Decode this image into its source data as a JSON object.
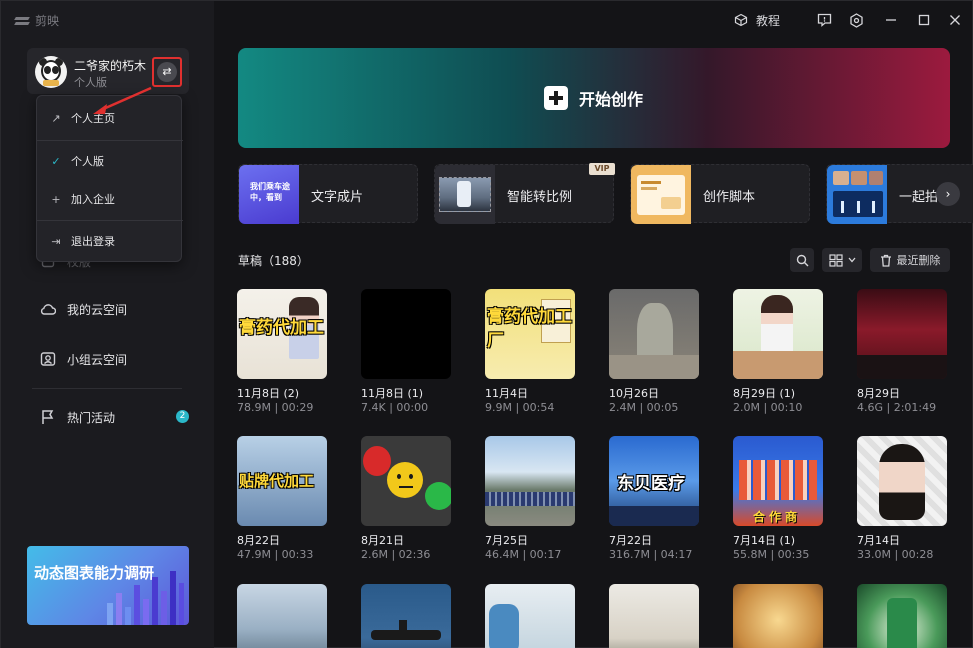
{
  "app": {
    "name": "剪映"
  },
  "topbar": {
    "tutorial_label": "教程"
  },
  "profile": {
    "name": "二爷家的朽木",
    "plan": "个人版"
  },
  "dropdown": {
    "items": [
      {
        "label": "个人主页",
        "icon": "arrow-up-right-icon"
      },
      {
        "label": "个人版",
        "icon": "check-icon"
      },
      {
        "label": "加入企业",
        "icon": "plus-icon"
      },
      {
        "label": "退出登录",
        "icon": "logout-icon"
      }
    ]
  },
  "sidebar": {
    "partial_label": "校版",
    "items": [
      {
        "label": "我的云空间",
        "icon": "cloud-icon"
      },
      {
        "label": "小组云空间",
        "icon": "group-icon"
      },
      {
        "label": "热门活动",
        "icon": "flag-icon",
        "badge": "2"
      }
    ],
    "banner_text": "动态图表能力调研"
  },
  "hero": {
    "label": "开始创作"
  },
  "tools": [
    {
      "label": "文字成片",
      "thumb_text": "我们乘车途中，看到"
    },
    {
      "label": "智能转比例",
      "badge": "VIP"
    },
    {
      "label": "创作脚本"
    },
    {
      "label": "一起拍"
    }
  ],
  "drafts": {
    "title": "草稿（188）",
    "recent_delete_label": "最近删除",
    "items": [
      {
        "date": "11月8日 (2)",
        "meta": "78.9M | 00:29",
        "thumb_text": "膏药代加工"
      },
      {
        "date": "11月8日 (1)",
        "meta": "7.4K | 00:00"
      },
      {
        "date": "11月4日",
        "meta": "9.9M | 00:54",
        "thumb_text": "膏药代加工厂"
      },
      {
        "date": "10月26日",
        "meta": "2.4M | 00:05"
      },
      {
        "date": "8月29日 (1)",
        "meta": "2.0M | 00:10"
      },
      {
        "date": "8月29日",
        "meta": "4.6G | 2:01:49"
      },
      {
        "date": "8月22日",
        "meta": "47.9M | 00:33",
        "thumb_text": "贴牌代加工"
      },
      {
        "date": "8月21日",
        "meta": "2.6M | 02:36"
      },
      {
        "date": "7月25日",
        "meta": "46.4M | 00:17"
      },
      {
        "date": "7月22日",
        "meta": "316.7M | 04:17",
        "thumb_text": "东贝医疗"
      },
      {
        "date": "7月14日 (1)",
        "meta": "55.8M | 00:35",
        "thumb_text": "合作商"
      },
      {
        "date": "7月14日",
        "meta": "33.0M | 00:28"
      },
      {},
      {},
      {},
      {},
      {},
      {}
    ]
  },
  "colors": {
    "accent": "#2bb8c9",
    "highlight_red": "#e0302f"
  }
}
